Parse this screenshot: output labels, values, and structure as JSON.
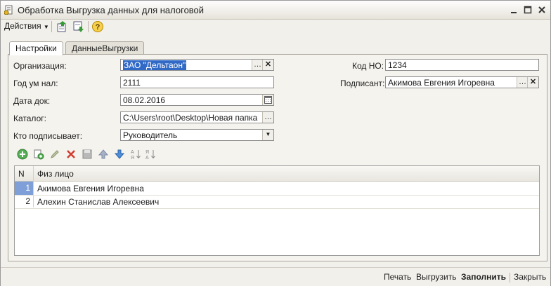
{
  "window": {
    "title": "Обработка  Выгрузка данных для налоговой",
    "icons": [
      "app-form-icon",
      "minimize-icon",
      "maximize-icon",
      "close-icon"
    ]
  },
  "toolbar": {
    "actions_label": "Действия",
    "icons": [
      "upload-icon",
      "download-icon",
      "help-icon"
    ]
  },
  "tabs": [
    {
      "label": "Настройки",
      "active": true
    },
    {
      "label": "ДанныеВыгрузки",
      "active": false
    }
  ],
  "form": {
    "organization": {
      "label": "Организация:",
      "value": "ЗАО \"Дельтаон\""
    },
    "year": {
      "label": "Год ум нал:",
      "value": "2111"
    },
    "date": {
      "label": "Дата док:",
      "value": "08.02.2016"
    },
    "catalog": {
      "label": "Каталог:",
      "value": "C:\\Users\\root\\Desktop\\Новая папка"
    },
    "signer_type": {
      "label": "Кто подписывает:",
      "value": "Руководитель"
    },
    "kod_no": {
      "label": "Код НО:",
      "value": "1234"
    },
    "signatory": {
      "label": "Подписант:",
      "value": "Акимова Евгения Игоревна"
    }
  },
  "list_toolbar": {
    "icons": [
      "add-icon",
      "copy-icon",
      "edit-icon",
      "delete-icon",
      "save-icon",
      "move-up-icon",
      "move-down-icon",
      "sort-asc-icon",
      "sort-desc-icon"
    ]
  },
  "table": {
    "columns": [
      "N",
      "Физ лицо"
    ],
    "rows": [
      {
        "n": "1",
        "fio": "Акимова Евгения Игоревна"
      },
      {
        "n": "2",
        "fio": "Алехин Станислав Алексеевич"
      }
    ]
  },
  "bottom_bar": {
    "print": "Печать",
    "export": "Выгрузить",
    "fill": "Заполнить",
    "close": "Закрыть"
  }
}
